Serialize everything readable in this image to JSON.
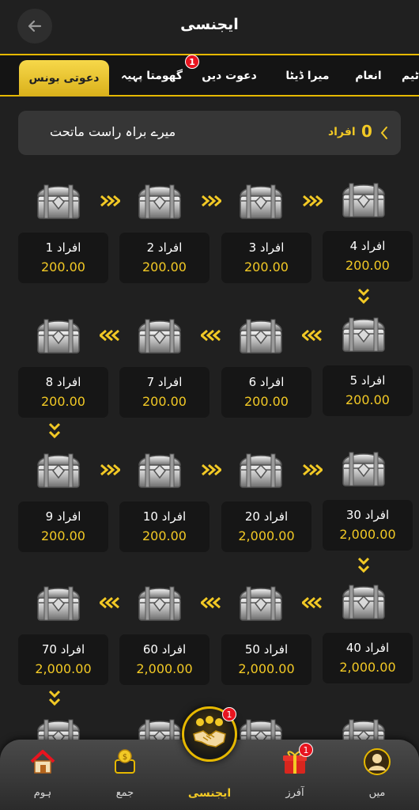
{
  "header": {
    "title": "ایجنسی"
  },
  "tabs": [
    {
      "label": "دعوتی بونس",
      "active": true
    },
    {
      "label": "گھومتا پہیہ",
      "badge": "1"
    },
    {
      "label": "دعوت دیں"
    },
    {
      "label": "میرا ڈیٹا"
    },
    {
      "label": "انعام"
    },
    {
      "label": "ٹیم"
    }
  ],
  "summary": {
    "count": "0",
    "unit": "افراد",
    "label": "میرے براہ راست ماتحت"
  },
  "tiers": [
    {
      "count": "1 افراد",
      "amount": "200.00"
    },
    {
      "count": "2 افراد",
      "amount": "200.00"
    },
    {
      "count": "3 افراد",
      "amount": "200.00"
    },
    {
      "count": "4 افراد",
      "amount": "200.00"
    },
    {
      "count": "5 افراد",
      "amount": "200.00"
    },
    {
      "count": "6 افراد",
      "amount": "200.00"
    },
    {
      "count": "7 افراد",
      "amount": "200.00"
    },
    {
      "count": "8 افراد",
      "amount": "200.00"
    },
    {
      "count": "9 افراد",
      "amount": "200.00"
    },
    {
      "count": "10 افراد",
      "amount": "200.00"
    },
    {
      "count": "20 افراد",
      "amount": "2,000.00"
    },
    {
      "count": "30 افراد",
      "amount": "2,000.00"
    },
    {
      "count": "40 افراد",
      "amount": "2,000.00"
    },
    {
      "count": "50 افراد",
      "amount": "2,000.00"
    },
    {
      "count": "60 افراد",
      "amount": "2,000.00"
    },
    {
      "count": "70 افراد",
      "amount": "2,000.00"
    }
  ],
  "nav": {
    "home": {
      "label": "ہوم",
      "icon": "home-icon"
    },
    "deposit": {
      "label": "جمع",
      "icon": "wallet-icon"
    },
    "agency": {
      "label": "ایجنسی",
      "icon": "handshake-icon",
      "badge": "1"
    },
    "offers": {
      "label": "آفرز",
      "icon": "gift-icon",
      "badge": "1"
    },
    "me": {
      "label": "میں",
      "icon": "user-icon"
    }
  },
  "colors": {
    "accent": "#f2c925",
    "background": "#202020",
    "badge": "#e8141f"
  }
}
